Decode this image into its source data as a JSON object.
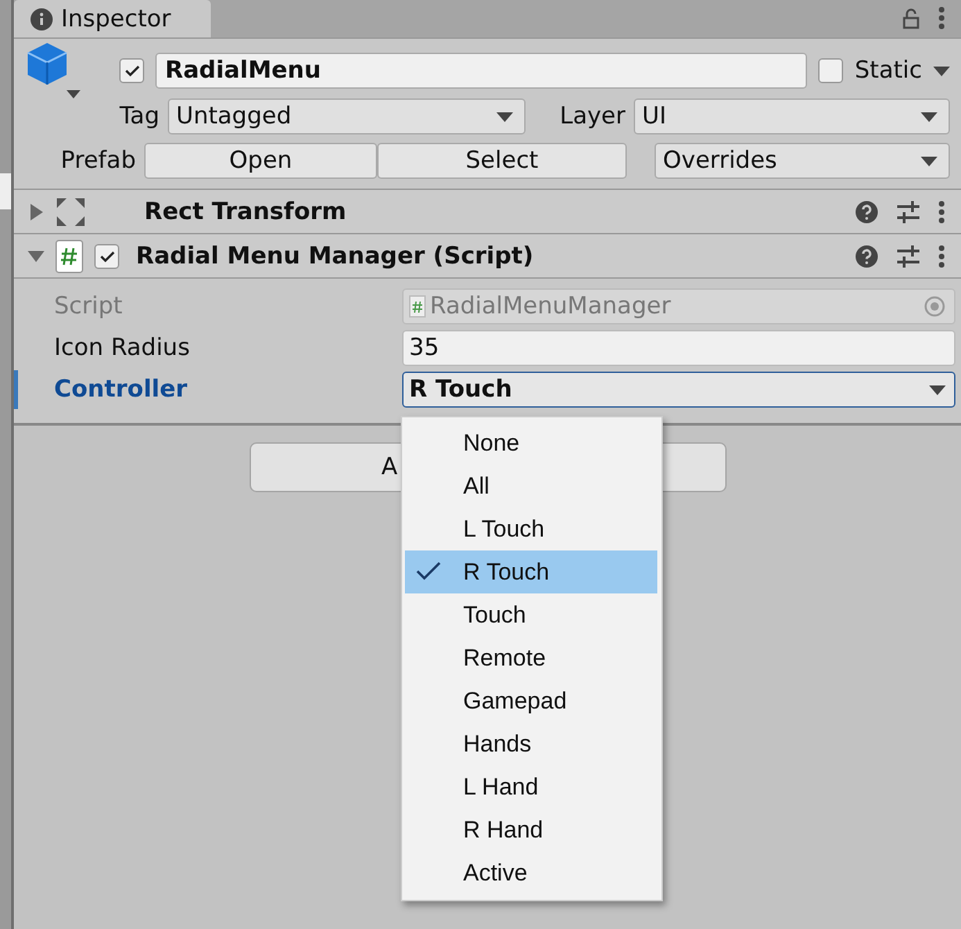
{
  "tab": {
    "title": "Inspector"
  },
  "object": {
    "active": true,
    "name": "RadialMenu",
    "static": false,
    "static_label": "Static",
    "tag_label": "Tag",
    "tag": "Untagged",
    "layer_label": "Layer",
    "layer": "UI",
    "prefab_label": "Prefab",
    "prefab_buttons": [
      "Open",
      "Select"
    ],
    "overrides": "Overrides"
  },
  "components": [
    {
      "kind": "transform",
      "title": "Rect Transform",
      "expanded": false
    },
    {
      "kind": "script",
      "title": "Radial Menu Manager (Script)",
      "expanded": true,
      "enabled": true
    }
  ],
  "fields": [
    {
      "kind": "object",
      "label": "Script",
      "value": "RadialMenuManager",
      "disabled": true,
      "focused": false
    },
    {
      "kind": "number",
      "label": "Icon Radius",
      "value": "35",
      "disabled": false,
      "focused": false
    },
    {
      "kind": "dropdown",
      "label": "Controller",
      "value": "R Touch",
      "disabled": false,
      "focused": true
    }
  ],
  "add_button": {
    "label": "A"
  },
  "menu": [
    {
      "label": "None",
      "selected": false
    },
    {
      "label": "All",
      "selected": false
    },
    {
      "label": "L Touch",
      "selected": false
    },
    {
      "label": "R Touch",
      "selected": true
    },
    {
      "label": "Touch",
      "selected": false
    },
    {
      "label": "Remote",
      "selected": false
    },
    {
      "label": "Gamepad",
      "selected": false
    },
    {
      "label": "Hands",
      "selected": false
    },
    {
      "label": "L Hand",
      "selected": false
    },
    {
      "label": "R Hand",
      "selected": false
    },
    {
      "label": "Active",
      "selected": false
    }
  ]
}
